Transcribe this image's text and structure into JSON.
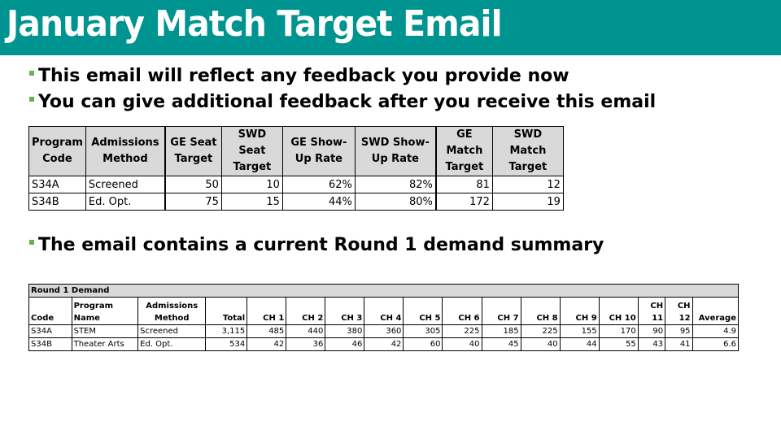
{
  "header": {
    "title": "January Match Target Email",
    "bg_color": "#009490"
  },
  "bullets": [
    "This email will reflect any feedback you provide now",
    "You can give additional feedback after you receive this email",
    "The email contains a current Round 1 demand summary"
  ],
  "bullet_color": "#66b245",
  "target_table": {
    "headers": [
      "Program Code",
      "Admissions Method",
      "GE Seat Target",
      "SWD Seat Target",
      "GE Show-Up Rate",
      "SWD Show-Up Rate",
      "GE Match Target",
      "SWD Match Target"
    ],
    "rows": [
      [
        "S34A",
        "Screened",
        "50",
        "10",
        "62%",
        "82%",
        "81",
        "12"
      ],
      [
        "S34B",
        "Ed. Opt.",
        "75",
        "15",
        "44%",
        "80%",
        "172",
        "19"
      ]
    ]
  },
  "demand_table": {
    "caption": "Round 1 Demand",
    "headers": [
      "Code",
      "Program Name",
      "Admissions Method",
      "Total",
      "CH 1",
      "CH 2",
      "CH 3",
      "CH 4",
      "CH 5",
      "CH 6",
      "CH 7",
      "CH 8",
      "CH 9",
      "CH 10",
      "CH 11",
      "CH 12",
      "Average"
    ],
    "rows": [
      [
        "S34A",
        "STEM",
        "Screened",
        "3,115",
        "485",
        "440",
        "380",
        "360",
        "305",
        "225",
        "185",
        "225",
        "155",
        "170",
        "90",
        "95",
        "4.9"
      ],
      [
        "S34B",
        "Theater Arts",
        "Ed. Opt.",
        "534",
        "42",
        "36",
        "46",
        "42",
        "60",
        "40",
        "45",
        "40",
        "44",
        "55",
        "43",
        "41",
        "6.6"
      ]
    ]
  }
}
